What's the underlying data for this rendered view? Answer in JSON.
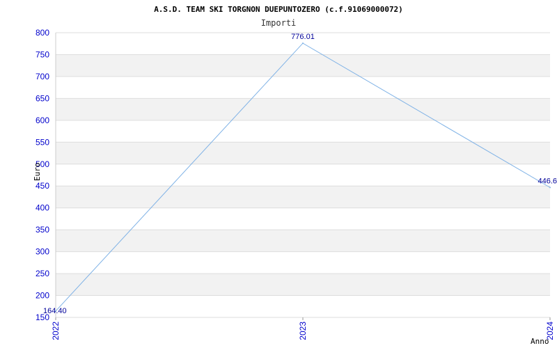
{
  "chart_data": {
    "type": "line",
    "title": "A.S.D. TEAM SKI TORGNON DUEPUNTOZERO (c.f.91069000072)",
    "subtitle": "Importi",
    "xlabel": "Anno",
    "ylabel": "Euro",
    "categories": [
      "2022",
      "2023",
      "2024"
    ],
    "series": [
      {
        "values": [
          164.4,
          776.01,
          446.6
        ]
      }
    ],
    "data_labels": [
      "164.40",
      "776.01",
      "446.6"
    ],
    "ylim": [
      150,
      800
    ],
    "yticks": [
      "150",
      "200",
      "250",
      "300",
      "350",
      "400",
      "450",
      "500",
      "550",
      "600",
      "650",
      "700",
      "750",
      "800"
    ],
    "grid": true,
    "colors": {
      "line": "#7fb2e6",
      "band": "#f2f2f2",
      "gridline": "#dddddd",
      "tick_text": "#0000cc",
      "data_label": "#000099"
    }
  }
}
